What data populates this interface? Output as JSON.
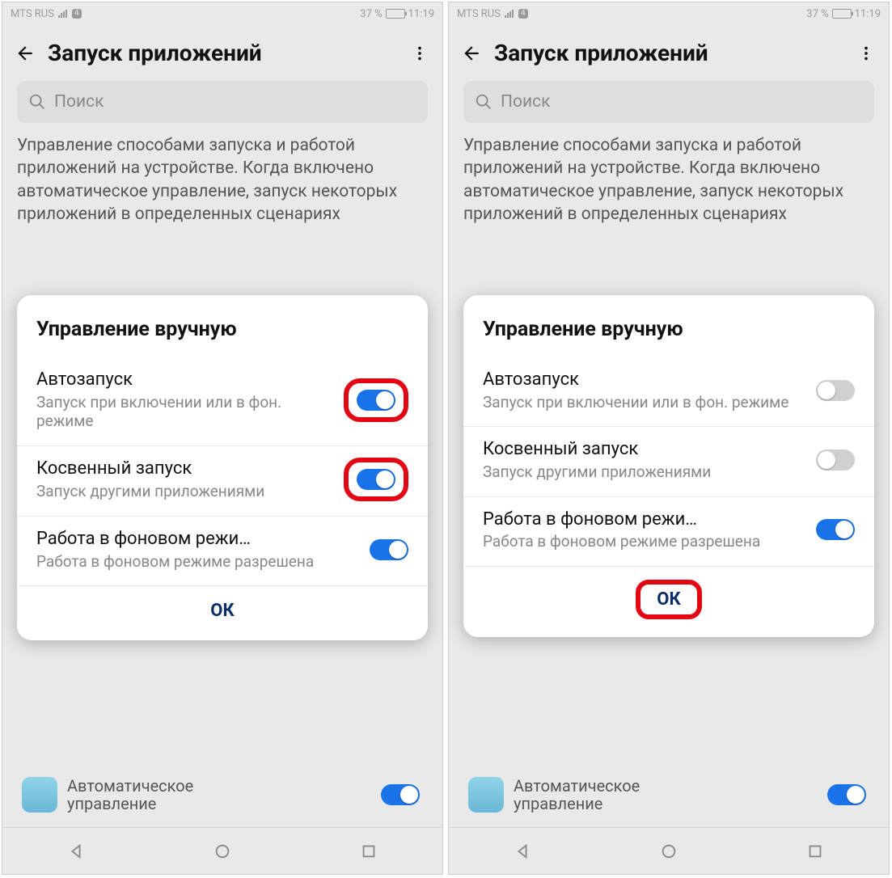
{
  "status": {
    "carrier": "MTS RUS",
    "badge": "4",
    "battery_pct": "37 %",
    "time": "11:19"
  },
  "header": {
    "title": "Запуск приложений"
  },
  "search": {
    "placeholder": "Поиск"
  },
  "description": "Управление способами запуска и работой приложений на устройстве. Когда включено автоматическое управление, запуск некоторых приложений в определенных сценариях",
  "dialog": {
    "title": "Управление вручную",
    "options": [
      {
        "title": "Автозапуск",
        "sub": "Запуск при включении или в фон. режиме"
      },
      {
        "title": "Косвенный запуск",
        "sub": "Запуск другими приложениями"
      },
      {
        "title": "Работа в фоновом режи…",
        "sub": "Работа в фоновом режиме разрешена"
      }
    ],
    "ok": "ОК"
  },
  "peek": {
    "line1": "Автоматическое",
    "line2": "управление"
  },
  "screens": [
    {
      "toggles": [
        true,
        true,
        true
      ],
      "highlight_toggles": [
        true,
        true,
        false
      ],
      "highlight_ok": false
    },
    {
      "toggles": [
        false,
        false,
        true
      ],
      "highlight_toggles": [
        false,
        false,
        false
      ],
      "highlight_ok": true
    }
  ]
}
